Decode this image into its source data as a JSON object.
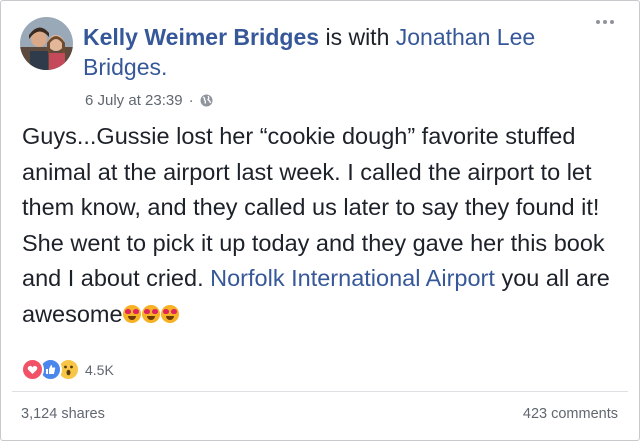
{
  "post": {
    "author": "Kelly Weimer Bridges",
    "with_text": "is with",
    "tagged": "Jonathan Lee Bridges.",
    "timestamp": "6 July at 23:39",
    "separator": "·",
    "privacy_icon": "globe-icon",
    "body_text": "Guys...Gussie lost her “cookie dough” favorite stuffed animal at the airport last week. I called the airport to let them know, and they called us later to say they found it! She went to pick it up today and they gave her this book and I about cried.",
    "body_link": "Norfolk International Airport",
    "body_suffix": "you all are awesome",
    "emojis": [
      "heart-eyes-emoji",
      "heart-eyes-emoji",
      "heart-eyes-emoji"
    ]
  },
  "reactions": {
    "icons": [
      "love-icon",
      "like-icon",
      "wow-icon"
    ],
    "count": "4.5K"
  },
  "footer": {
    "shares": "3,124 shares",
    "comments": "423 comments"
  },
  "colors": {
    "link": "#365899",
    "text": "#1d2129",
    "secondary": "#616770"
  }
}
